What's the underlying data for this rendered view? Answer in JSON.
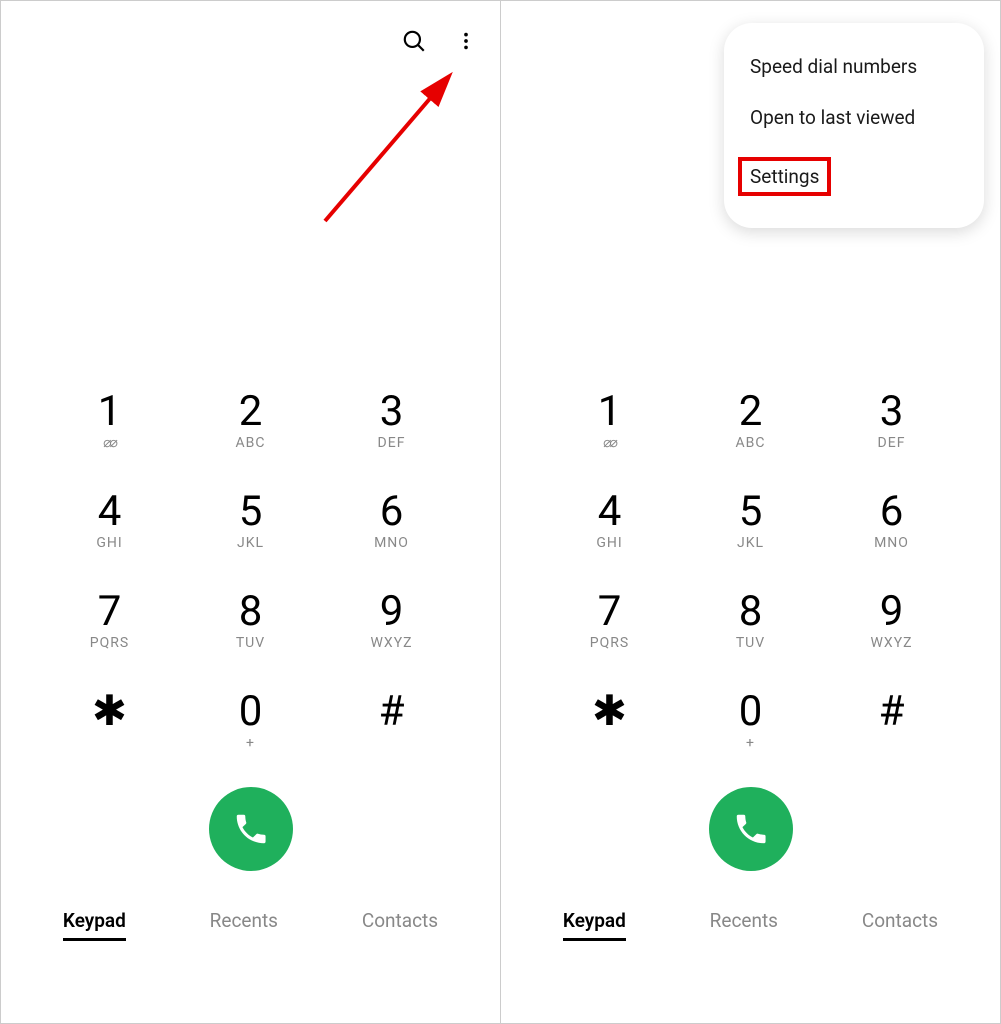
{
  "left": {
    "keys": [
      {
        "d": "1",
        "s": "voicemail"
      },
      {
        "d": "2",
        "s": "ABC"
      },
      {
        "d": "3",
        "s": "DEF"
      },
      {
        "d": "4",
        "s": "GHI"
      },
      {
        "d": "5",
        "s": "JKL"
      },
      {
        "d": "6",
        "s": "MNO"
      },
      {
        "d": "7",
        "s": "PQRS"
      },
      {
        "d": "8",
        "s": "TUV"
      },
      {
        "d": "9",
        "s": "WXYZ"
      },
      {
        "d": "✱",
        "s": ""
      },
      {
        "d": "0",
        "s": "+"
      },
      {
        "d": "#",
        "s": ""
      }
    ],
    "tabs": {
      "keypad": "Keypad",
      "recents": "Recents",
      "contacts": "Contacts"
    }
  },
  "right": {
    "menu": {
      "speed": "Speed dial numbers",
      "lastviewed": "Open to last viewed",
      "settings": "Settings"
    },
    "keys": [
      {
        "d": "1",
        "s": "voicemail"
      },
      {
        "d": "2",
        "s": "ABC"
      },
      {
        "d": "3",
        "s": "DEF"
      },
      {
        "d": "4",
        "s": "GHI"
      },
      {
        "d": "5",
        "s": "JKL"
      },
      {
        "d": "6",
        "s": "MNO"
      },
      {
        "d": "7",
        "s": "PQRS"
      },
      {
        "d": "8",
        "s": "TUV"
      },
      {
        "d": "9",
        "s": "WXYZ"
      },
      {
        "d": "✱",
        "s": ""
      },
      {
        "d": "0",
        "s": "+"
      },
      {
        "d": "#",
        "s": ""
      }
    ],
    "tabs": {
      "keypad": "Keypad",
      "recents": "Recents",
      "contacts": "Contacts"
    }
  }
}
